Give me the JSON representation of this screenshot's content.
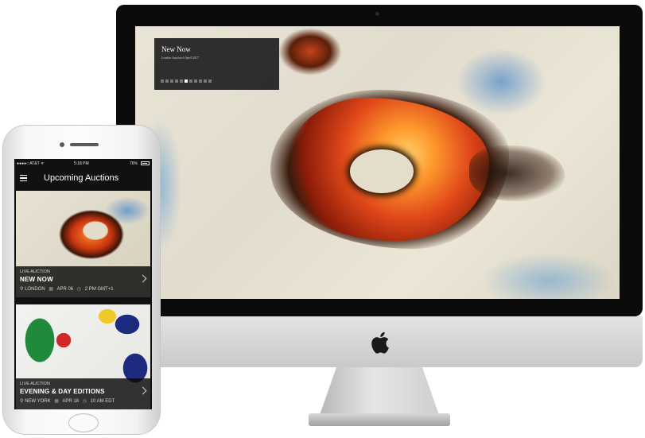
{
  "desktop": {
    "hero": {
      "title": "New Now",
      "subtitle": "London Auction 6 April 2017",
      "slide_count": 11,
      "active_slide": 6
    }
  },
  "mobile": {
    "status_bar": {
      "carrier": "●●●●○ AT&T ᯤ",
      "time": "5:18 PM",
      "battery": "76%"
    },
    "header": {
      "menu_icon": "hamburger-menu-icon",
      "title": "Upcoming Auctions"
    },
    "auctions": [
      {
        "label": "LIVE AUCTION",
        "title": "NEW NOW",
        "location": "LONDON",
        "date": "APR 06",
        "time": "2 PM GMT+1"
      },
      {
        "label": "LIVE AUCTION",
        "title": "EVENING & DAY EDITIONS",
        "location": "NEW YORK",
        "date": "APR 18",
        "time": "10 AM EDT"
      }
    ]
  }
}
